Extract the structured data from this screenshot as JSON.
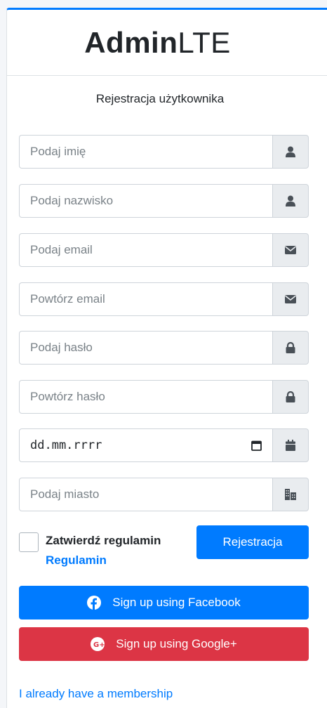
{
  "logo": {
    "bold": "Admin",
    "light": "LTE"
  },
  "form": {
    "title": "Rejestracja użytkownika",
    "fields": [
      {
        "placeholder": "Podaj imię",
        "icon": "user-icon"
      },
      {
        "placeholder": "Podaj nazwisko",
        "icon": "user-icon"
      },
      {
        "placeholder": "Podaj email",
        "icon": "envelope-icon"
      },
      {
        "placeholder": "Powtórz email",
        "icon": "envelope-icon"
      },
      {
        "placeholder": "Podaj hasło",
        "icon": "lock-icon"
      },
      {
        "placeholder": "Powtórz hasło",
        "icon": "lock-icon"
      },
      {
        "placeholder": "dd.mm.rrrr",
        "icon": "calendar-icon"
      },
      {
        "placeholder": "Podaj miasto",
        "icon": "city-icon"
      }
    ],
    "terms_label": "Zatwierdź regulamin",
    "terms_link": "Regulamin",
    "register_button": "Rejestracja"
  },
  "social": {
    "facebook": "Sign up using Facebook",
    "google": "Sign up using Google+"
  },
  "membership_link": "I already have a membership",
  "colors": {
    "primary": "#007bff",
    "danger": "#dc3545",
    "addon_bg": "#e9ecef"
  }
}
